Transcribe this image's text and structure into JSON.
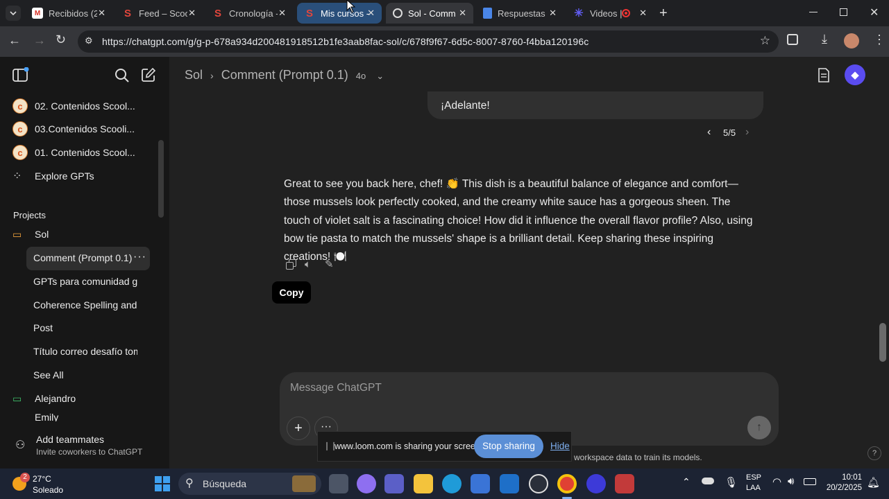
{
  "browser": {
    "tabs": [
      {
        "title": "Recibidos (2",
        "icon": "gmail-icon"
      },
      {
        "title": "Feed – Scool",
        "icon": "scoolinary-icon"
      },
      {
        "title": "Cronología -",
        "icon": "scoolinary-icon"
      },
      {
        "title": "Mis cursos -",
        "icon": "scoolinary-icon"
      },
      {
        "title": "Sol - Comm",
        "icon": "chatgpt-icon"
      },
      {
        "title": "Respuestas F",
        "icon": "docs-icon"
      },
      {
        "title": "Videos |",
        "icon": "loom-icon"
      }
    ],
    "url": "https://chatgpt.com/g/g-p-678a934d200481918512b1fe3aab8fac-sol/c/678f9f67-6d5c-8007-8760-f4bba120196c"
  },
  "sidebar": {
    "gpts": [
      {
        "label": "02. Contenidos Scool...",
        "avatar": "c"
      },
      {
        "label": "03.Contenidos Scooli...",
        "avatar": "c"
      },
      {
        "label": "01. Contenidos Scool...",
        "avatar": "c"
      }
    ],
    "explore_label": "Explore GPTs",
    "projects_heading": "Projects",
    "project_name": "Sol",
    "chats": [
      "Comment (Prompt 0.1)",
      "GPTs para comunidad ga",
      "Coherence Spelling and r",
      "Post",
      "Título correo desafío tom"
    ],
    "see_all": "See All",
    "project2": "Alejandro",
    "project3": "Emily",
    "add_teammates": "Add teammates",
    "add_teammates_sub": "Invite coworkers to ChatGPT"
  },
  "header": {
    "crumb_project": "Sol",
    "crumb_chat": "Comment (Prompt 0.1)",
    "model": "4o"
  },
  "chat": {
    "user_text": "¡Adelante!",
    "pager": "5/5",
    "assistant_text": "Great to see you back here, chef! 👏 This dish is a beautiful balance of elegance and comfort—those mussels look perfectly cooked, and the creamy white sauce has a gorgeous sheen. The touch of violet salt is a fascinating choice! How did it influence the overall flavor profile? Also, using bow tie pasta to match the mussels' shape is a brilliant detail. Keep sharing these inspiring creations! 🍽️",
    "tooltip": "Copy"
  },
  "composer": {
    "placeholder": "Message ChatGPT",
    "footer_note": "workspace data to train its models."
  },
  "loom": {
    "message": "www.loom.com is sharing your screen.",
    "stop": "Stop sharing",
    "hide": "Hide"
  },
  "taskbar": {
    "weather_temp": "27°C",
    "weather_desc": "Soleado",
    "weather_badge": "2",
    "search_placeholder": "Búsqueda",
    "lang1": "ESP",
    "lang2": "LAA",
    "time": "10:01",
    "date": "20/2/2025"
  },
  "colors": {
    "accent_blue": "#4f86c6",
    "stop_button": "#5b8fd6",
    "loom_bg": "#1a1a1a"
  }
}
